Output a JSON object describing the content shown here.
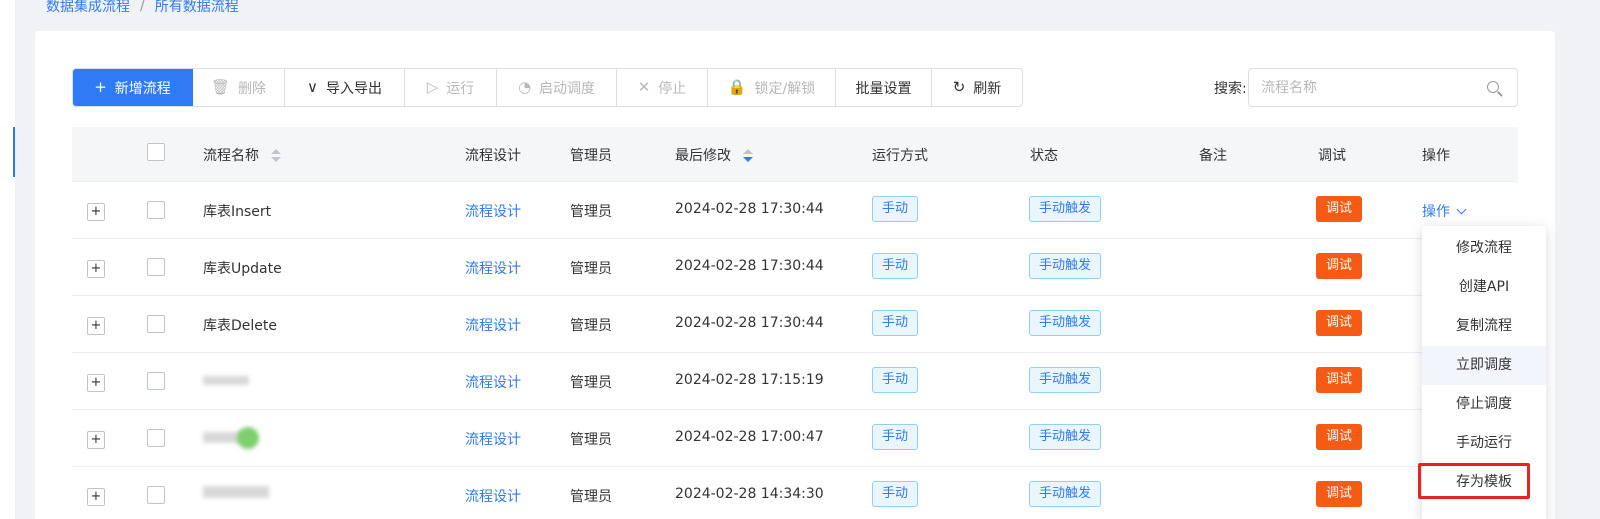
{
  "breadcrumb": {
    "items": [
      "数据集成流程",
      "所有数据流程"
    ],
    "separator": "/"
  },
  "toolbar": {
    "buttons": [
      {
        "label": "新增流程",
        "icon": "plus-icon",
        "glyph": "+"
      },
      {
        "label": "删除",
        "icon": "trash-icon",
        "glyph": "🗑"
      },
      {
        "label": "导入导出",
        "icon": "chevron-down-icon",
        "glyph": "∨"
      },
      {
        "label": "运行",
        "icon": "play-icon",
        "glyph": "▷"
      },
      {
        "label": "启动调度",
        "icon": "clock-icon",
        "glyph": "◔"
      },
      {
        "label": "停止",
        "icon": "close-icon",
        "glyph": "✕"
      },
      {
        "label": "锁定/解锁",
        "icon": "lock-icon",
        "glyph": "🔒"
      },
      {
        "label": "批量设置",
        "icon": "",
        "glyph": ""
      },
      {
        "label": "刷新",
        "icon": "refresh-icon",
        "glyph": "↻"
      }
    ]
  },
  "search": {
    "label": "搜索:",
    "placeholder": "流程名称"
  },
  "table": {
    "columns": [
      "流程名称",
      "流程设计",
      "管理员",
      "最后修改",
      "运行方式",
      "状态",
      "备注",
      "调试",
      "操作"
    ],
    "rows": [
      {
        "name": "库表Insert",
        "design": "流程设计",
        "admin": "管理员",
        "modified": "2024-02-28 17:30:44",
        "run_mode": "手动",
        "status": "手动触发",
        "debug": "调试",
        "ops": "操作"
      },
      {
        "name": "库表Update",
        "design": "流程设计",
        "admin": "管理员",
        "modified": "2024-02-28 17:30:44",
        "run_mode": "手动",
        "status": "手动触发",
        "debug": "调试",
        "ops": ""
      },
      {
        "name": "库表Delete",
        "design": "流程设计",
        "admin": "管理员",
        "modified": "2024-02-28 17:30:44",
        "run_mode": "手动",
        "status": "手动触发",
        "debug": "调试",
        "ops": ""
      },
      {
        "name": "",
        "design": "流程设计",
        "admin": "管理员",
        "modified": "2024-02-28 17:15:19",
        "run_mode": "手动",
        "status": "手动触发",
        "debug": "调试",
        "ops": ""
      },
      {
        "name": "",
        "design": "流程设计",
        "admin": "管理员",
        "modified": "2024-02-28 17:00:47",
        "run_mode": "手动",
        "status": "手动触发",
        "debug": "调试",
        "ops": ""
      },
      {
        "name": "",
        "design": "流程设计",
        "admin": "管理员",
        "modified": "2024-02-28 14:34:30",
        "run_mode": "手动",
        "status": "手动触发",
        "debug": "调试",
        "ops": ""
      }
    ]
  },
  "dropdown": {
    "items": [
      "修改流程",
      "创建API",
      "复制流程",
      "立即调度",
      "停止调度",
      "手动运行",
      "存为模板"
    ]
  },
  "colors": {
    "primary": "#2f7bf5",
    "debug": "#f55b14",
    "highlight": "#e8221f"
  }
}
